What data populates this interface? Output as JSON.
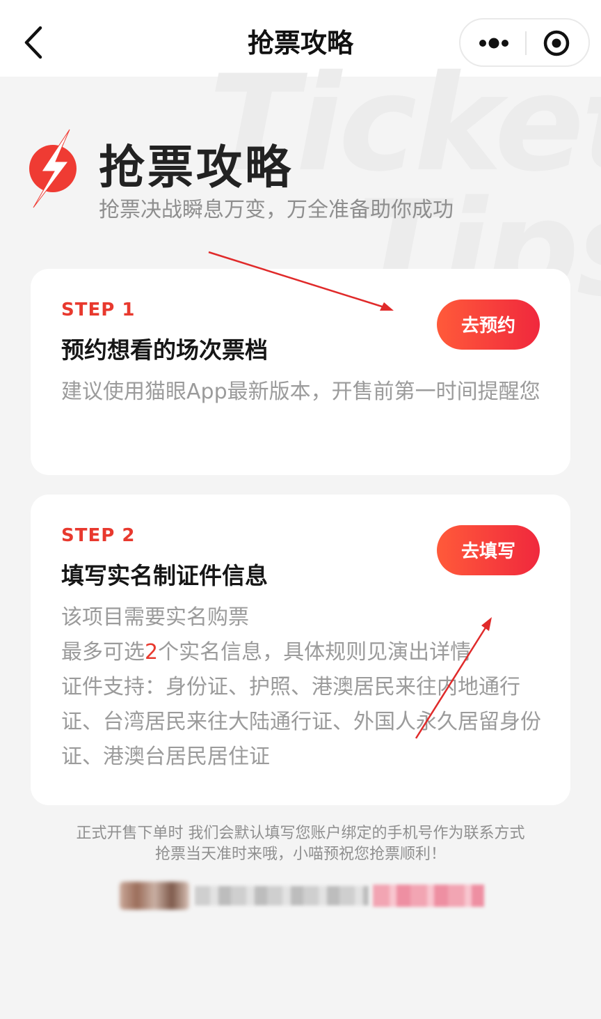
{
  "navbar": {
    "title": "抢票攻略"
  },
  "hero": {
    "watermark_line1": "Ticket",
    "watermark_line2": "Tips",
    "title": "抢票攻略",
    "subtitle": "抢票决战瞬息万变，万全准备助你成功"
  },
  "steps": [
    {
      "label": "STEP 1",
      "title": "预约想看的场次票档",
      "description": "建议使用猫眼App最新版本，开售前第一时间提醒您",
      "button": "去预约"
    },
    {
      "label": "STEP 2",
      "title": "填写实名制证件信息",
      "line1": "该项目需要实名购票",
      "line2_prefix": "最多可选",
      "line2_count": "2",
      "line2_suffix": "个实名信息，具体规则见演出详情",
      "line3": "证件支持：身份证、护照、港澳居民来往内地通行证、台湾居民来往大陆通行证、外国人永久居留身份证、港澳台居民居住证",
      "button": "去填写"
    }
  ],
  "footer": {
    "line1": "正式开售下单时 我们会默认填写您账户绑定的手机号作为联系方式",
    "line2": "抢票当天准时来哦，小喵预祝您抢票顺利！"
  },
  "colors": {
    "accent": "#e8392e",
    "button_gradient_start": "#ff5a3a",
    "button_gradient_end": "#f0283d",
    "annotation": "#e02a2a"
  },
  "icons": {
    "back": "chevron-left-icon",
    "more": "more-dots-icon",
    "close": "target-circle-icon",
    "logo": "lightning-bolt-icon"
  }
}
